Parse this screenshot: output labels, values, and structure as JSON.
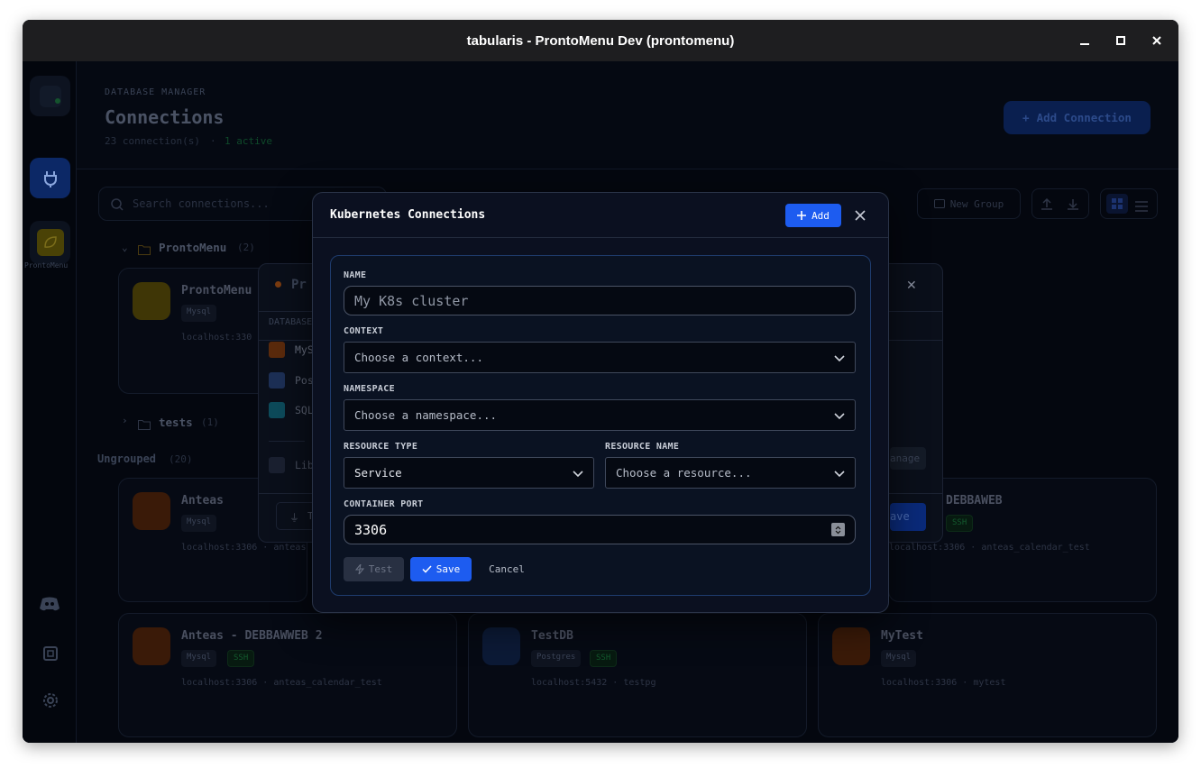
{
  "window": {
    "title": "tabularis - ProntoMenu Dev (prontomenu)",
    "minimize_icon": "minimize-icon",
    "maximize_icon": "maximize-icon",
    "close_icon": "close-icon"
  },
  "sidebar": {
    "connection_label": "ProntoMenu"
  },
  "header": {
    "section_label": "DATABASE MANAGER",
    "title": "Connections",
    "count": "23 connection(s)",
    "separator": "·",
    "active": "1 active",
    "add_connection": "Add Connection"
  },
  "toolbar": {
    "search_placeholder": "Search connections...",
    "new_group": "New Group"
  },
  "groups": [
    {
      "name": "ProntoMenu",
      "count": "(2)"
    },
    {
      "name": "tests",
      "count": "(1)"
    }
  ],
  "ungrouped": {
    "label": "Ungrouped",
    "count": "(20)"
  },
  "cards": [
    {
      "title": "ProntoMenu",
      "driver": "Mysql",
      "sub": "localhost:330"
    },
    {
      "title": "Anteas",
      "driver": "Mysql",
      "sub": "localhost:3306 · anteas"
    },
    {
      "title": "DEBBAWEB",
      "driver": "Mysql",
      "ssh": "SSH",
      "sub": "localhost:3306 · anteas_calendar_test"
    },
    {
      "title": "Anteas - DEBBAWWEB 2",
      "driver": "Mysql",
      "ssh": "SSH",
      "sub": "localhost:3306 · anteas_calendar_test"
    },
    {
      "title": "TestDB",
      "driver": "Postgres",
      "ssh": "SSH",
      "sub": "localhost:5432 · testpg"
    },
    {
      "title": "MyTest",
      "driver": "Mysql",
      "sub": "localhost:3306 · mytest"
    }
  ],
  "back_modal": {
    "title_fragment": "Pr",
    "section": "DATABASE",
    "drivers": [
      "MyS",
      "Pos",
      "SQL"
    ],
    "lib": "Lib",
    "test_fragment": "T",
    "manage_fragment": "anage",
    "save_fragment": "ave"
  },
  "modal": {
    "title": "Kubernetes Connections",
    "add_label": "Add",
    "close_icon": "close-icon",
    "name_label": "NAME",
    "name_placeholder": "My K8s cluster",
    "context_label": "CONTEXT",
    "context_value": "Choose a context...",
    "namespace_label": "NAMESPACE",
    "namespace_value": "Choose a namespace...",
    "resource_type_label": "RESOURCE TYPE",
    "resource_type_value": "Service",
    "resource_name_label": "RESOURCE NAME",
    "resource_name_value": "Choose a resource...",
    "port_label": "CONTAINER PORT",
    "port_value": "3306",
    "test_label": "Test",
    "save_label": "Save",
    "cancel_label": "Cancel"
  },
  "colors": {
    "accent": "#1d5cf0",
    "modal_bg": "#0b1020",
    "form_border": "#1f3c6e",
    "active_green": "#22c55e"
  }
}
